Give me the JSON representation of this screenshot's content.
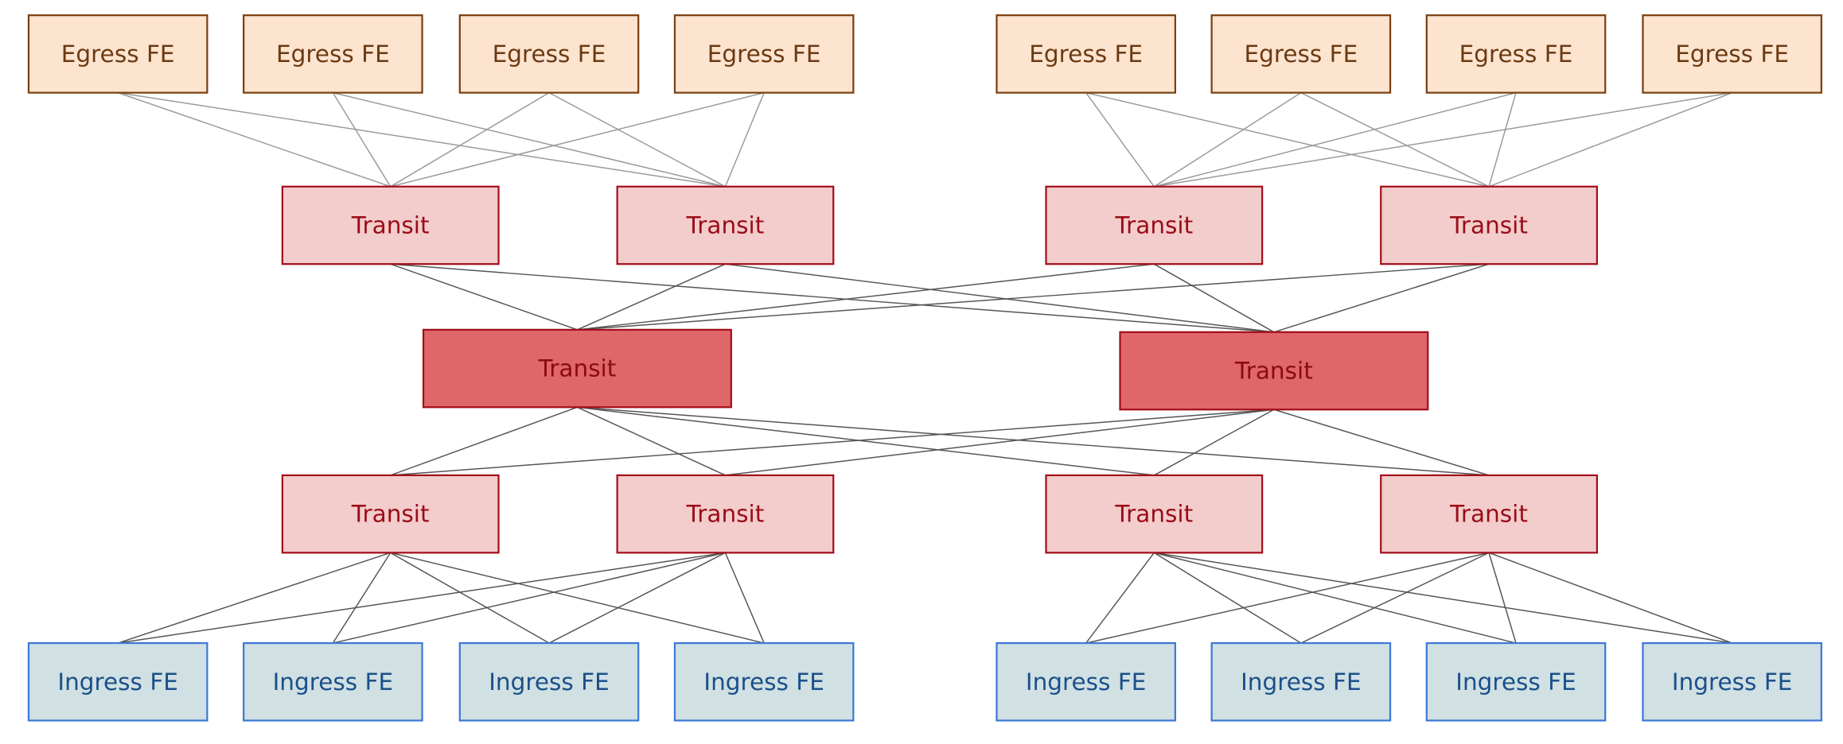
{
  "colors": {
    "egress_fill": "#fce4cf",
    "egress_stroke": "#7a3f0f",
    "egress_text": "#6b3a12",
    "transit_fill": "#f3cccc",
    "transit_stroke": "#a30d1a",
    "transit_text": "#9a0c16",
    "core_fill": "#df6769",
    "core_stroke": "#a30d1a",
    "core_text": "#8b0a12",
    "ingress_fill": "#d0e0e3",
    "ingress_stroke": "#3c78d8",
    "ingress_text": "#1b4f8a",
    "edge_upper": "#9a9a9a",
    "edge_lower": "#555555"
  },
  "nodes": {
    "egress": [
      "Egress FE",
      "Egress FE",
      "Egress FE",
      "Egress FE",
      "Egress FE",
      "Egress FE",
      "Egress FE",
      "Egress FE"
    ],
    "transit_upper": [
      "Transit",
      "Transit",
      "Transit",
      "Transit"
    ],
    "transit_core": [
      "Transit",
      "Transit"
    ],
    "transit_lower": [
      "Transit",
      "Transit",
      "Transit",
      "Transit"
    ],
    "ingress": [
      "Ingress FE",
      "Ingress FE",
      "Ingress FE",
      "Ingress FE",
      "Ingress FE",
      "Ingress FE",
      "Ingress FE",
      "Ingress FE"
    ]
  },
  "edges": [
    [
      "egress.0",
      "transit_upper.0"
    ],
    [
      "egress.0",
      "transit_upper.1"
    ],
    [
      "egress.1",
      "transit_upper.0"
    ],
    [
      "egress.1",
      "transit_upper.1"
    ],
    [
      "egress.2",
      "transit_upper.0"
    ],
    [
      "egress.2",
      "transit_upper.1"
    ],
    [
      "egress.3",
      "transit_upper.0"
    ],
    [
      "egress.3",
      "transit_upper.1"
    ],
    [
      "egress.4",
      "transit_upper.2"
    ],
    [
      "egress.4",
      "transit_upper.3"
    ],
    [
      "egress.5",
      "transit_upper.2"
    ],
    [
      "egress.5",
      "transit_upper.3"
    ],
    [
      "egress.6",
      "transit_upper.2"
    ],
    [
      "egress.6",
      "transit_upper.3"
    ],
    [
      "egress.7",
      "transit_upper.2"
    ],
    [
      "egress.7",
      "transit_upper.3"
    ],
    [
      "transit_upper.0",
      "transit_core.0"
    ],
    [
      "transit_upper.0",
      "transit_core.1"
    ],
    [
      "transit_upper.1",
      "transit_core.0"
    ],
    [
      "transit_upper.1",
      "transit_core.1"
    ],
    [
      "transit_upper.2",
      "transit_core.0"
    ],
    [
      "transit_upper.2",
      "transit_core.1"
    ],
    [
      "transit_upper.3",
      "transit_core.0"
    ],
    [
      "transit_upper.3",
      "transit_core.1"
    ],
    [
      "transit_core.0",
      "transit_lower.0"
    ],
    [
      "transit_core.0",
      "transit_lower.1"
    ],
    [
      "transit_core.0",
      "transit_lower.2"
    ],
    [
      "transit_core.0",
      "transit_lower.3"
    ],
    [
      "transit_core.1",
      "transit_lower.0"
    ],
    [
      "transit_core.1",
      "transit_lower.1"
    ],
    [
      "transit_core.1",
      "transit_lower.2"
    ],
    [
      "transit_core.1",
      "transit_lower.3"
    ],
    [
      "transit_lower.0",
      "ingress.0"
    ],
    [
      "transit_lower.0",
      "ingress.1"
    ],
    [
      "transit_lower.0",
      "ingress.2"
    ],
    [
      "transit_lower.0",
      "ingress.3"
    ],
    [
      "transit_lower.1",
      "ingress.0"
    ],
    [
      "transit_lower.1",
      "ingress.1"
    ],
    [
      "transit_lower.1",
      "ingress.2"
    ],
    [
      "transit_lower.1",
      "ingress.3"
    ],
    [
      "transit_lower.2",
      "ingress.4"
    ],
    [
      "transit_lower.2",
      "ingress.5"
    ],
    [
      "transit_lower.2",
      "ingress.6"
    ],
    [
      "transit_lower.2",
      "ingress.7"
    ],
    [
      "transit_lower.3",
      "ingress.4"
    ],
    [
      "transit_lower.3",
      "ingress.5"
    ],
    [
      "transit_lower.3",
      "ingress.6"
    ],
    [
      "transit_lower.3",
      "ingress.7"
    ]
  ]
}
